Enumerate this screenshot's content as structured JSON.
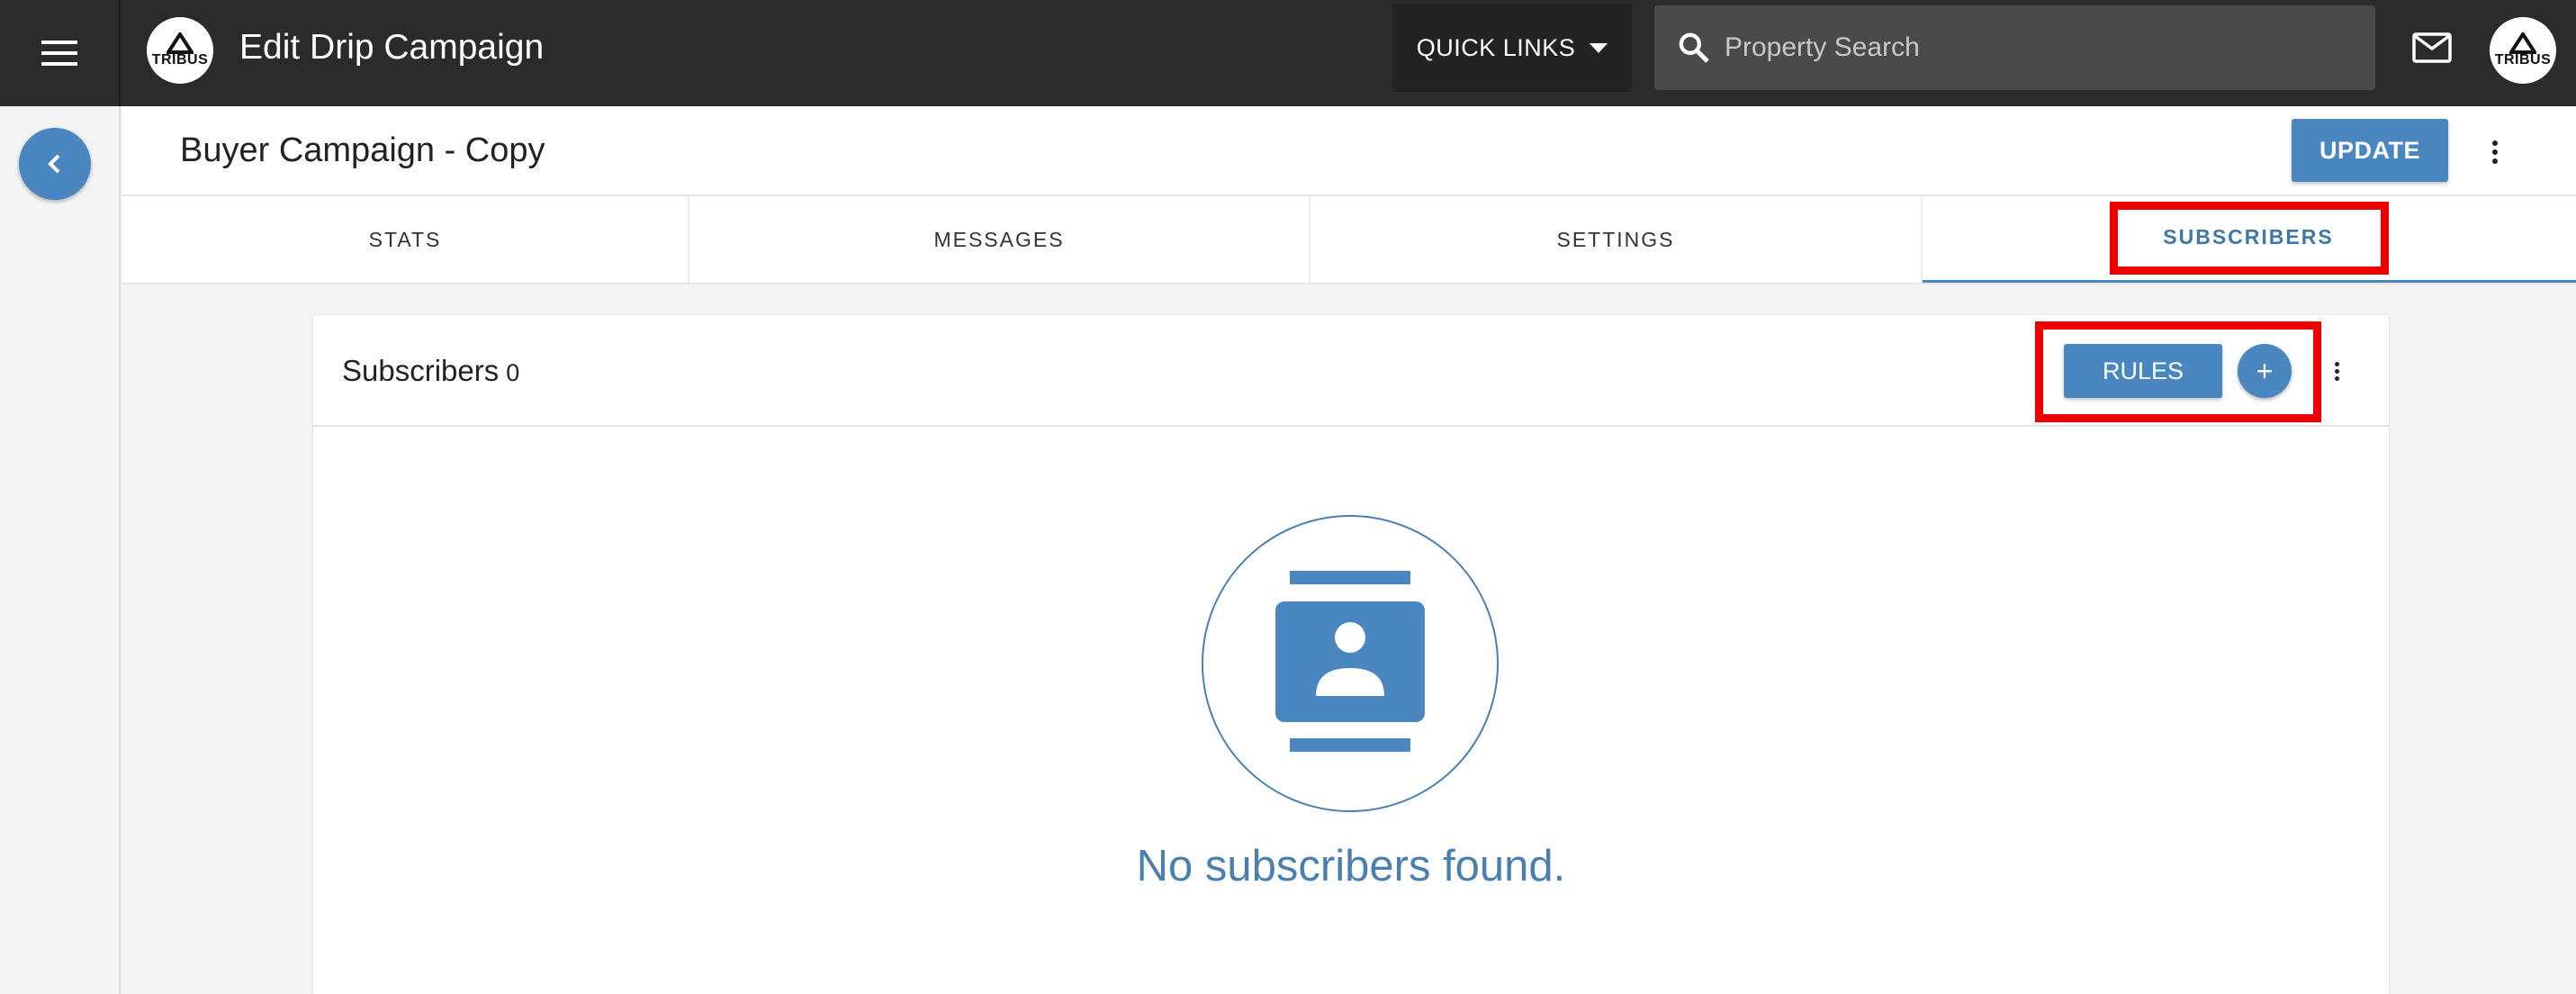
{
  "topbar": {
    "title": "Edit Drip Campaign",
    "logo_text": "TRIBUS",
    "quick_links_label": "QUICK LINKS",
    "search_placeholder": "Property Search"
  },
  "header": {
    "campaign_name": "Buyer Campaign - Copy",
    "update_label": "UPDATE"
  },
  "tabs": [
    {
      "label": "STATS"
    },
    {
      "label": "MESSAGES"
    },
    {
      "label": "SETTINGS"
    },
    {
      "label": "SUBSCRIBERS",
      "active": true
    }
  ],
  "subscribers": {
    "title": "Subscribers",
    "count": "0",
    "rules_label": "RULES",
    "add_symbol": "+",
    "empty_message": "No subscribers found."
  },
  "colors": {
    "accent": "#4a86bf",
    "topbar": "#2b2b2b",
    "highlight": "#ee0000"
  },
  "icons": [
    "menu-icon",
    "search-icon",
    "mail-icon",
    "chevron-left-icon",
    "more-vertical-icon",
    "contact-card-icon"
  ]
}
